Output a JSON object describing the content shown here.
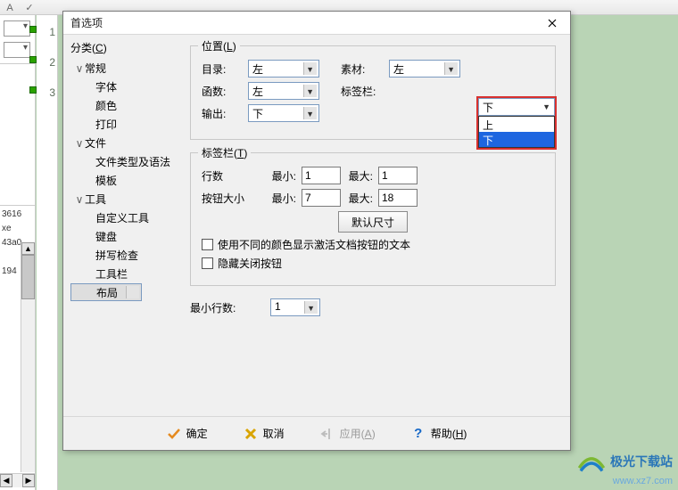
{
  "toolbar_icons": [
    "new-icon",
    "open-icon",
    "save-icon",
    "cut-icon",
    "copy-icon",
    "paste-icon",
    "undo-icon",
    "redo-icon",
    "font-icon",
    "sub-icon",
    "sup-icon",
    "bookmark-icon",
    "compare-icon",
    "view1-icon",
    "view2-icon",
    "panel-icon",
    "web-icon"
  ],
  "line_numbers": [
    "1",
    "2",
    "3"
  ],
  "left_items": [
    "3616",
    "xe",
    "43a0",
    "",
    "194"
  ],
  "dialog": {
    "title": "首选项",
    "tree_label": "分类",
    "tree_label_key": "C",
    "tree": [
      {
        "label": "常规",
        "open": true,
        "children": [
          "字体",
          "颜色",
          "打印"
        ]
      },
      {
        "label": "文件",
        "open": true,
        "children": [
          "文件类型及语法",
          "模板"
        ]
      },
      {
        "label": "工具",
        "open": true,
        "children": [
          "自定义工具",
          "键盘",
          "拼写检查",
          "工具栏",
          "布局"
        ]
      }
    ],
    "selected": "布局",
    "groups": {
      "position": {
        "legend": "位置",
        "legend_key": "L",
        "rows": [
          {
            "l1": "目录:",
            "v1": "左",
            "l2": "素材:",
            "v2": "左"
          },
          {
            "l1": "函数:",
            "v1": "左",
            "l2": "标签栏:",
            "v2": "下"
          },
          {
            "l1": "输出:",
            "v1": "下"
          }
        ],
        "dropdown": {
          "current": "下",
          "options": [
            "上",
            "下"
          ],
          "highlight": "下"
        }
      },
      "tabbar": {
        "legend": "标签栏",
        "legend_key": "T",
        "rows_label": "行数",
        "btn_label": "按钮大小",
        "min_label": "最小:",
        "max_label": "最大:",
        "rows_min": "1",
        "rows_max": "1",
        "btn_min": "7",
        "btn_max": "18",
        "default_btn": "默认尺寸",
        "chk1": "使用不同的颜色显示激活文档按钮的文本",
        "chk2": "隐藏关闭按钮"
      },
      "min_rows": {
        "label": "最小行数:",
        "value": "1"
      }
    },
    "buttons": {
      "ok": "确定",
      "cancel": "取消",
      "apply": "应用",
      "apply_key": "A",
      "help": "帮助",
      "help_key": "H"
    }
  },
  "watermark": {
    "text": "极光下载站",
    "url": "www.xz7.com"
  }
}
